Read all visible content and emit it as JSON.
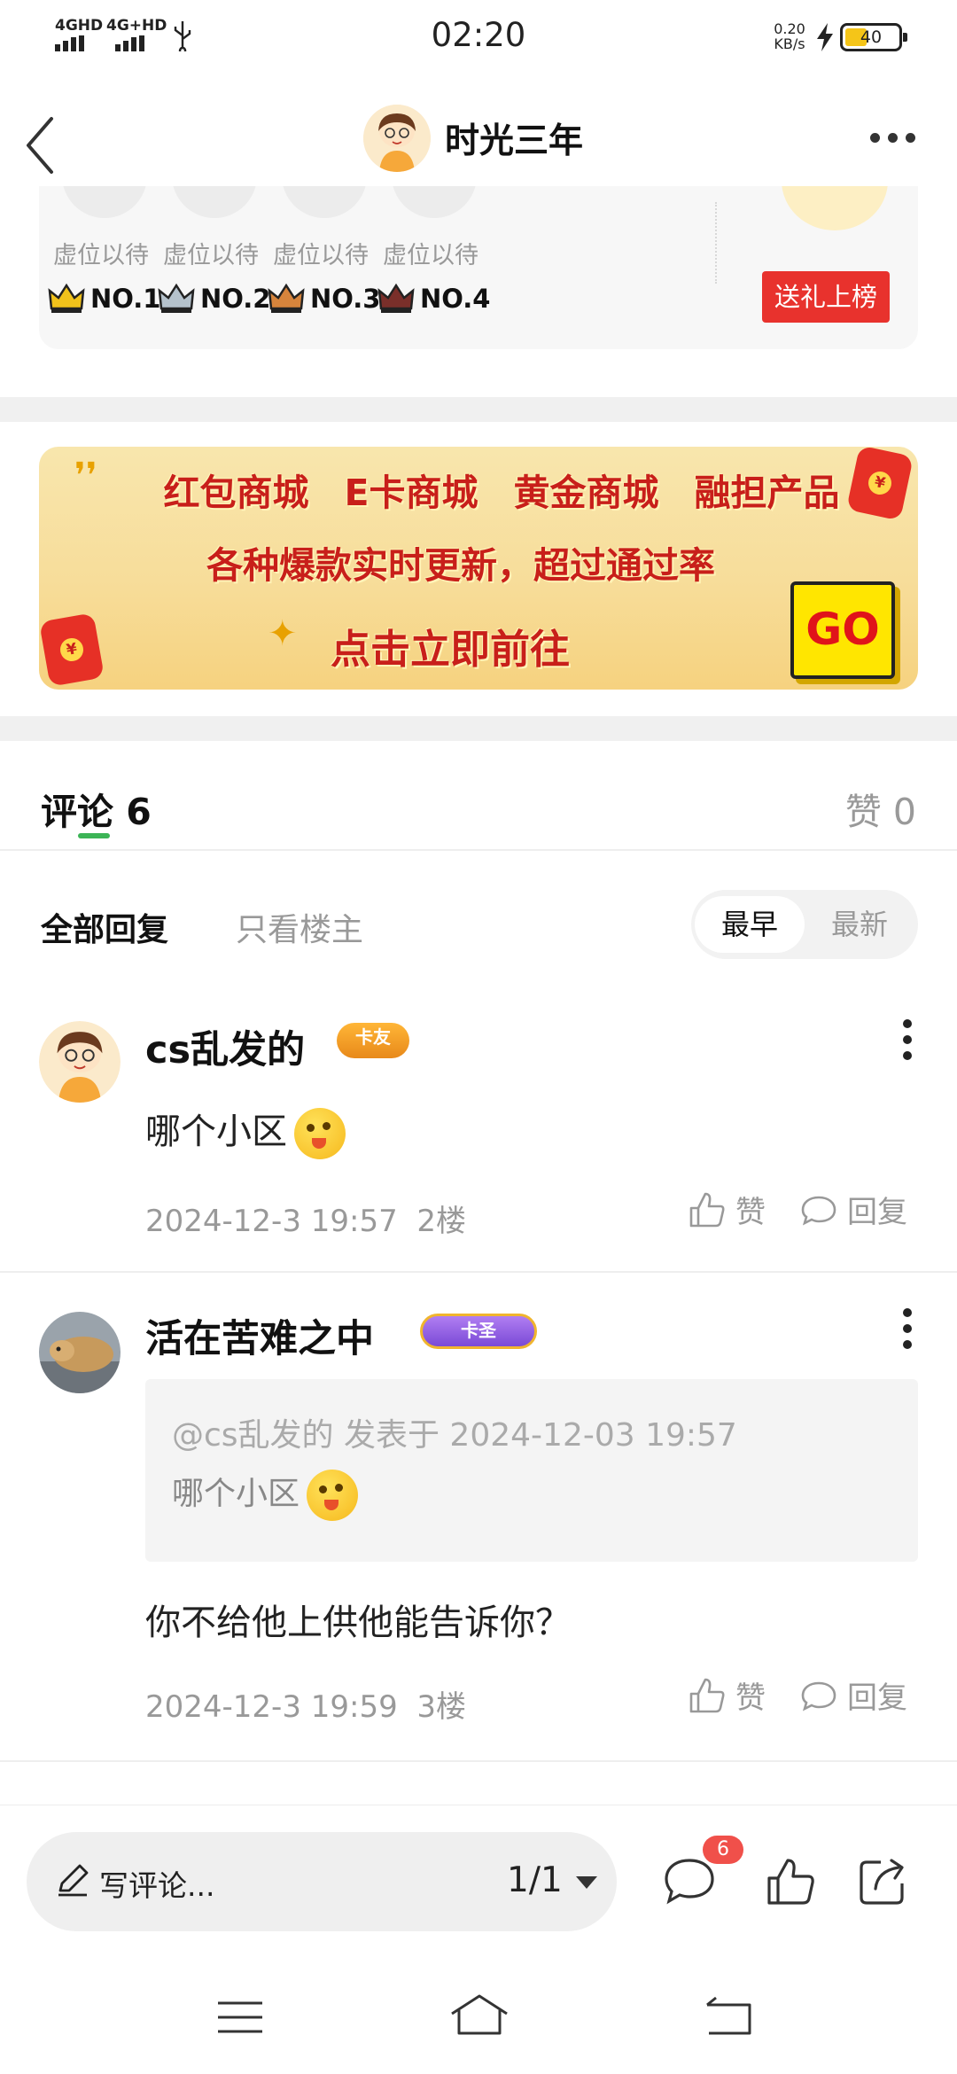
{
  "status_bar": {
    "network_1": "4GHD",
    "network_2": "4G+HD",
    "time": "02:20",
    "speed_value": "0.20",
    "speed_unit": "KB/s",
    "battery": "40"
  },
  "header": {
    "title": "时光三年"
  },
  "ranking": {
    "slots": [
      {
        "label": "虚位以待",
        "rank": "NO.1",
        "crown_color": "#f1c21b"
      },
      {
        "label": "虚位以待",
        "rank": "NO.2",
        "crown_color": "#b5c2cc"
      },
      {
        "label": "虚位以待",
        "rank": "NO.3",
        "crown_color": "#d6843c"
      },
      {
        "label": "虚位以待",
        "rank": "NO.4",
        "crown_color": "#7a2f2a"
      }
    ],
    "gift_button": "送礼上榜"
  },
  "banner": {
    "line1": [
      "红包商城",
      "E卡商城",
      "黄金商城",
      "融担产品"
    ],
    "line2": "各种爆款实时更新，超过通过率",
    "line3": "点击立即前往",
    "go": "GO"
  },
  "tabs": {
    "comments": "评论 6",
    "likes": "赞 0",
    "accent": "#3cb456"
  },
  "filters": {
    "all": "全部回复",
    "op_only": "只看楼主",
    "sort_earliest": "最早",
    "sort_latest": "最新"
  },
  "comments": [
    {
      "name": "cs乱发的",
      "badge": "卡友",
      "text": "哪个小区",
      "time": "2024-12-3 19:57",
      "floor": "2楼",
      "like": "赞",
      "reply": "回复"
    },
    {
      "name": "活在苦难之中",
      "badge": "卡圣",
      "quote_head": "@cs乱发的 发表于 2024-12-03 19:57",
      "quote_text": "哪个小区",
      "text": "你不给他上供他能告诉你？",
      "time": "2024-12-3 19:59",
      "floor": "3楼",
      "like": "赞",
      "reply": "回复"
    }
  ],
  "bottom_bar": {
    "compose_placeholder": "写评论...",
    "page": "1/1",
    "comment_count": "6"
  },
  "icons": {
    "back": "back-arrow-icon",
    "more": "more-dots-icon",
    "comment": "comment-bubble-icon",
    "like": "thumbs-up-icon",
    "share": "share-icon",
    "menu": "menu-icon",
    "home": "home-icon",
    "return": "return-icon"
  }
}
